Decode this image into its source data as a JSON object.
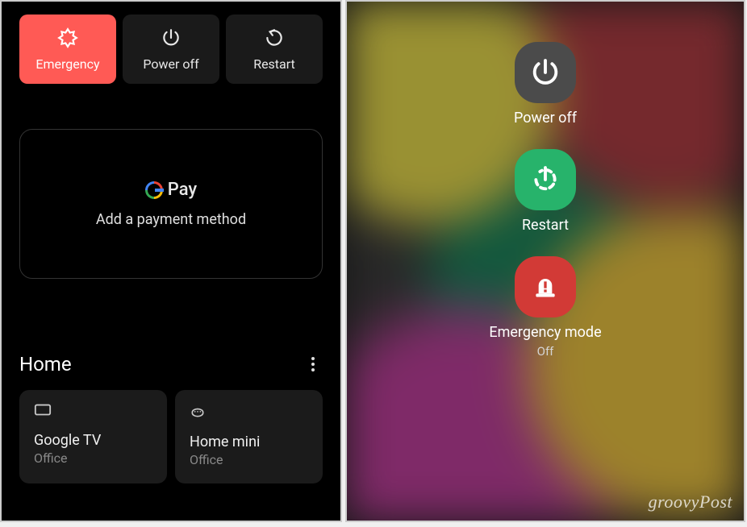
{
  "left": {
    "power_buttons": {
      "emergency": "Emergency",
      "power_off": "Power off",
      "restart": "Restart"
    },
    "gpay": {
      "brand": "Pay",
      "subtitle": "Add a payment method"
    },
    "home": {
      "title": "Home",
      "devices": [
        {
          "name": "Google TV",
          "room": "Office"
        },
        {
          "name": "Home mini",
          "room": "Office"
        }
      ]
    }
  },
  "right": {
    "items": {
      "power_off": "Power off",
      "restart": "Restart",
      "emergency": "Emergency mode",
      "emergency_state": "Off"
    },
    "watermark": "groovyPost"
  }
}
